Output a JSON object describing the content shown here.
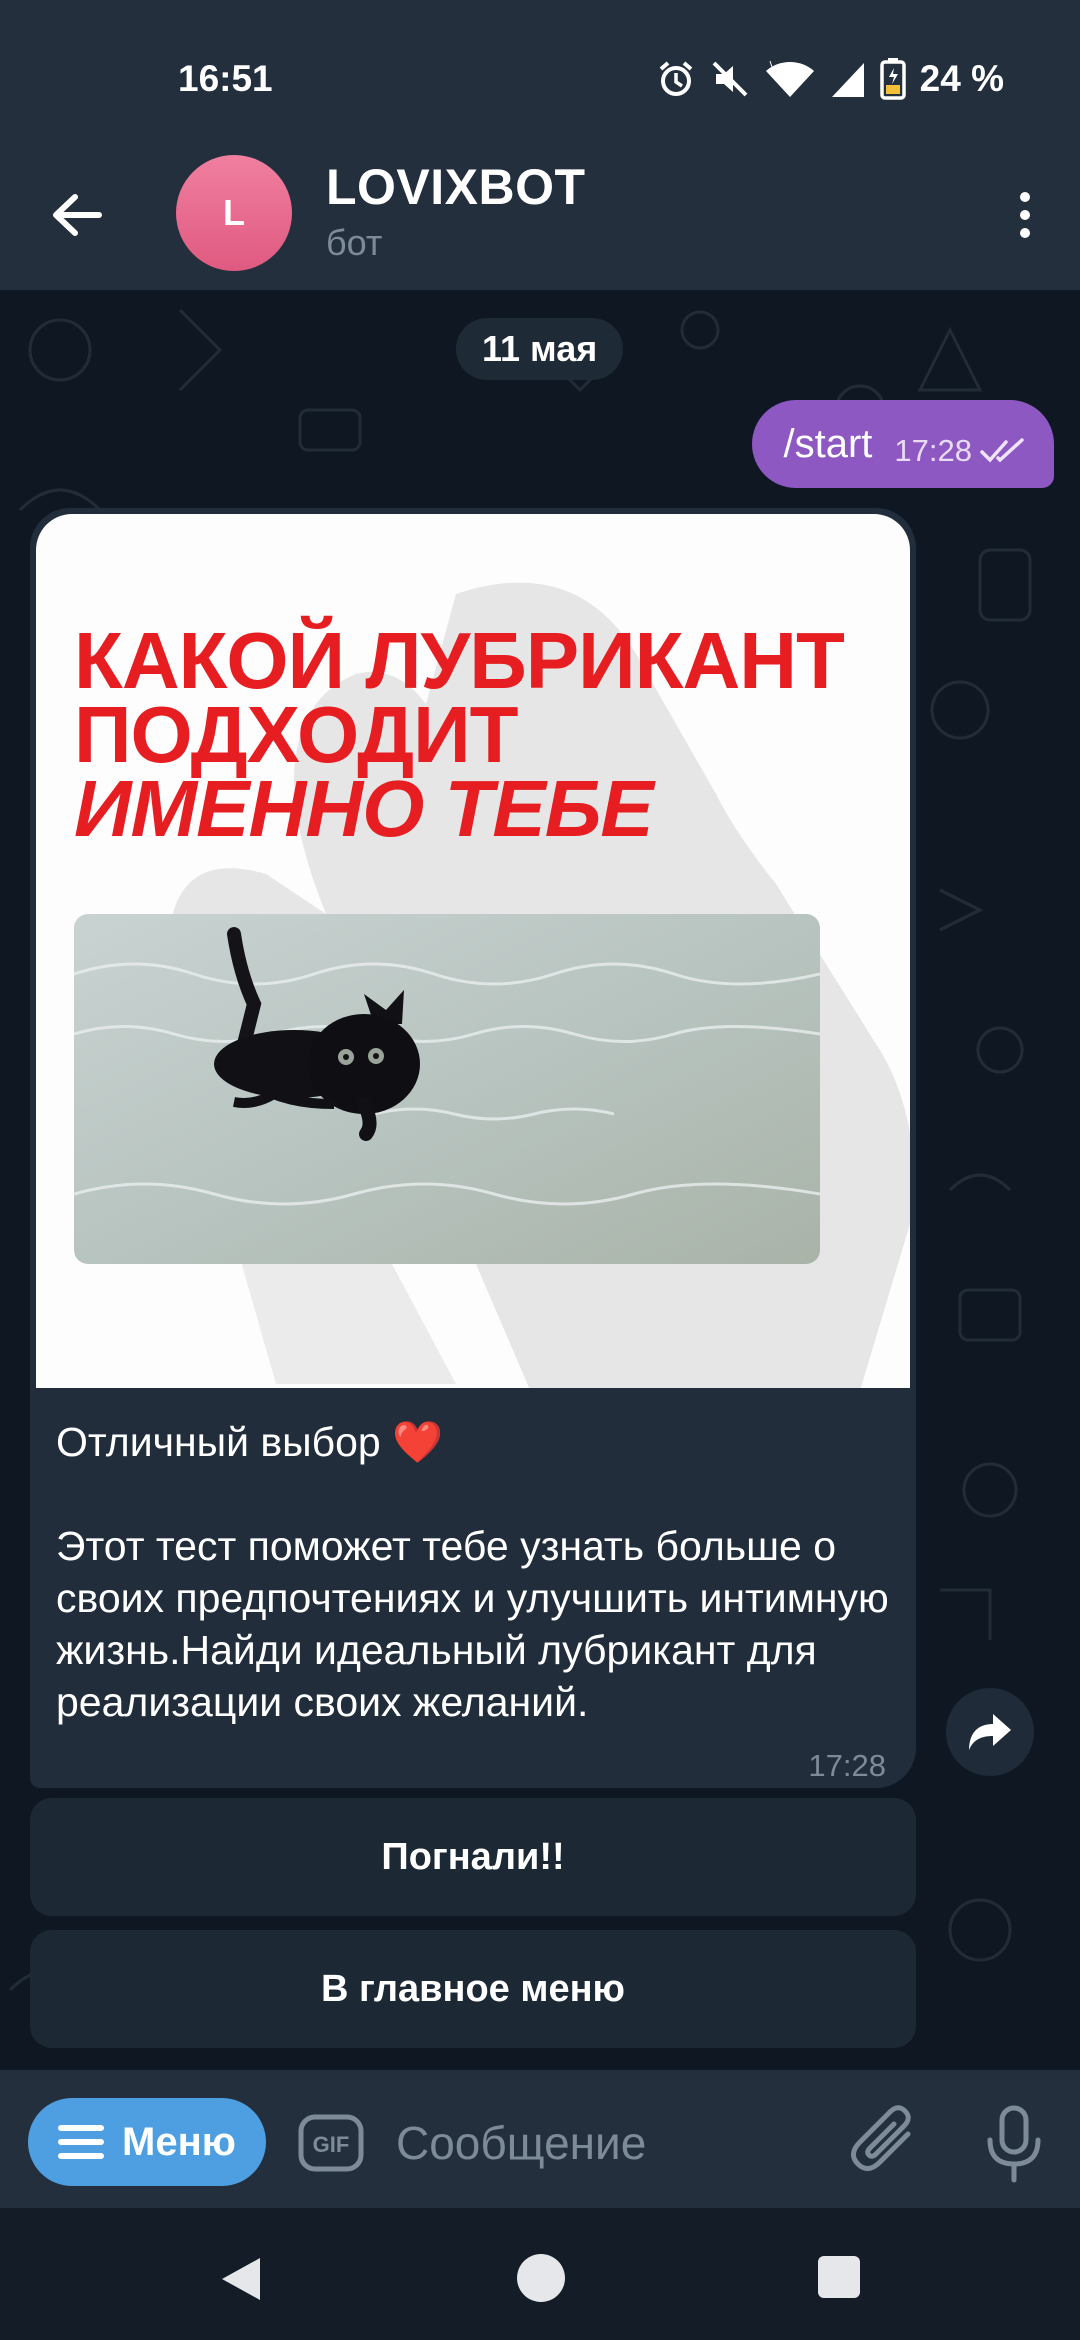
{
  "status_bar": {
    "time": "16:51",
    "battery": "24 %",
    "icons": [
      "alarm-icon",
      "mute-icon",
      "wifi-icon",
      "signal-icon",
      "battery-icon"
    ]
  },
  "header": {
    "avatar_letter": "L",
    "title": "LOVIXBOT",
    "subtitle": "бот",
    "icons": [
      "back-arrow-icon",
      "more-vertical-icon"
    ]
  },
  "chat": {
    "date": "11 мая",
    "outgoing": {
      "text": "/start",
      "time": "17:28",
      "status_icon": "double-check-icon"
    },
    "incoming": {
      "image_text": {
        "line1": "КАКОЙ ЛУБРИКАНТ",
        "line2": "ПОДХОДИТ",
        "line3": "ИМЕННО ТЕБЕ"
      },
      "text_line1": "Отличный выбор ❤️",
      "text_body": "Этот тест поможет тебе узнать больше о своих предпочтениях и улучшить интимную жизнь.Найди идеальный лубрикант для реализации своих желаний.",
      "time": "17:28"
    },
    "buttons": [
      "Погнали!!",
      "В главное меню"
    ]
  },
  "input": {
    "menu_label": "Меню",
    "placeholder": "Сообщение",
    "icons": [
      "gif-icon",
      "attach-icon",
      "mic-icon"
    ]
  },
  "colors": {
    "header_bg": "#232f3d",
    "chat_bg": "#0f1822",
    "outgoing_bubble": "#8e58c2",
    "incoming_bubble": "#212d3b",
    "menu_button": "#4e9fe1",
    "headline_red": "#e61e22"
  }
}
